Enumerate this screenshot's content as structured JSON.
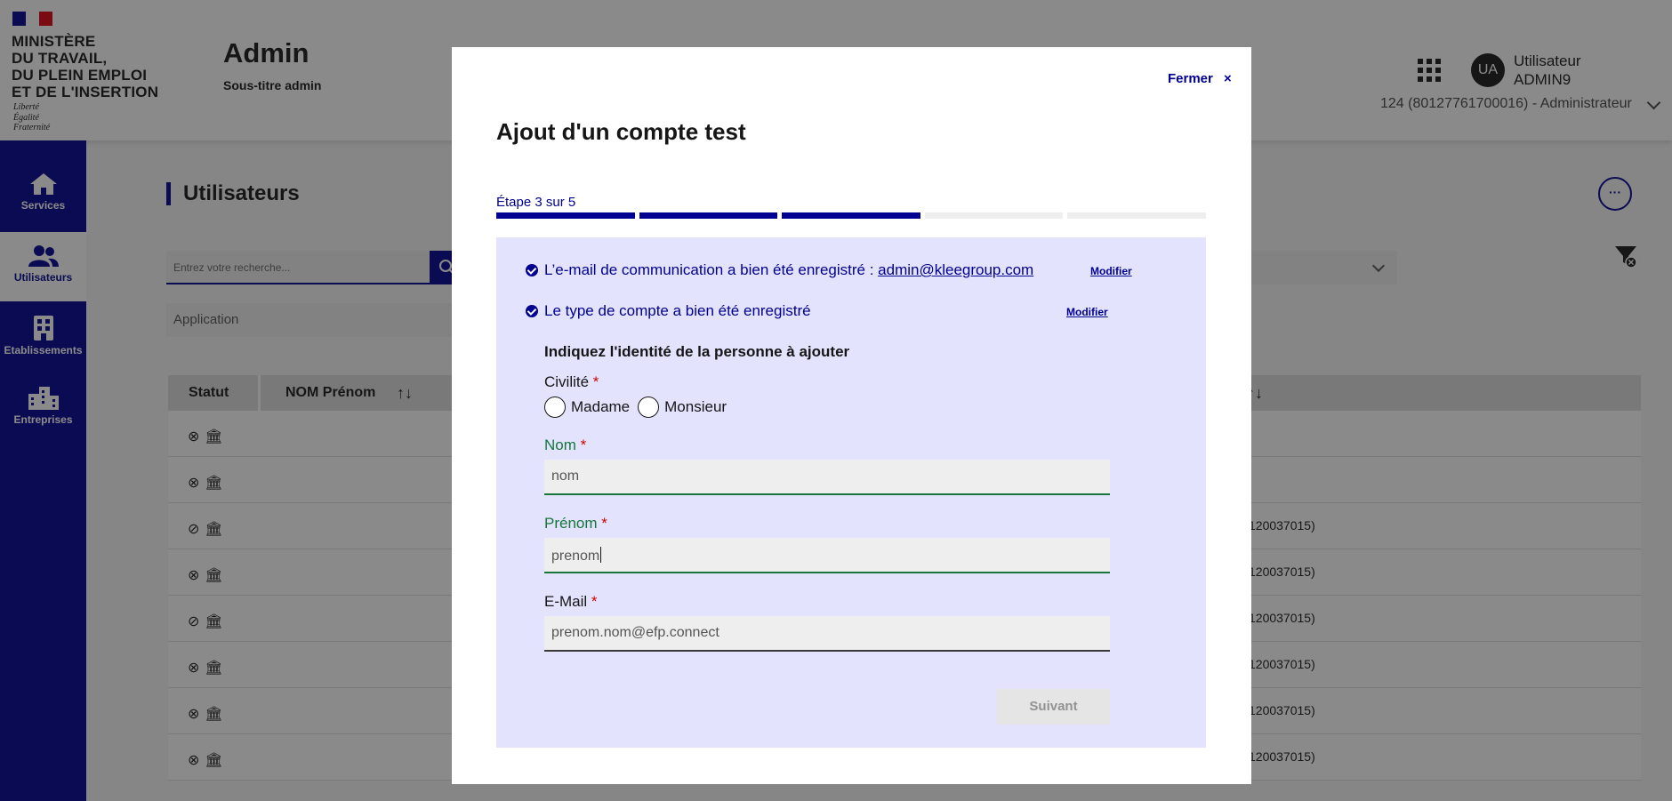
{
  "header": {
    "ministry_lines": [
      "MINISTÈRE",
      "DU TRAVAIL,",
      "DU PLEIN EMPLOI",
      "ET DE L'INSERTION"
    ],
    "motto_lines": [
      "Liberté",
      "Égalité",
      "Fraternité"
    ],
    "app_title": "Admin",
    "app_subtitle": "Sous-titre admin",
    "avatar_initials": "UA",
    "user_first": "Utilisateur",
    "user_last": "ADMIN9",
    "user_role": "124 (80127761700016) - Administrateur",
    "flag_colors": [
      "#000091",
      "#ffffff",
      "#e1000f"
    ]
  },
  "sidebar": {
    "items": [
      {
        "label": "Services",
        "icon": "home-icon",
        "active": false
      },
      {
        "label": "Utilisateurs",
        "icon": "users-icon",
        "active": true
      },
      {
        "label": "Etablissements",
        "icon": "building-icon",
        "active": false
      },
      {
        "label": "Entreprises",
        "icon": "city-icon",
        "active": false
      }
    ]
  },
  "main": {
    "page_title": "Utilisateurs",
    "more_label": "···",
    "search_placeholder": "Entrez votre recherche...",
    "select_application": "Application",
    "columns": [
      "Statut",
      "NOM Prénom"
    ],
    "sort_glyph": "↑↓",
    "rows": [
      {
        "status": "inactive",
        "right": ""
      },
      {
        "status": "inactive",
        "right": ""
      },
      {
        "status": "active",
        "right": "120037015)"
      },
      {
        "status": "inactive",
        "right": "120037015)"
      },
      {
        "status": "active",
        "right": "120037015)"
      },
      {
        "status": "inactive",
        "right": "120037015)"
      },
      {
        "status": "inactive",
        "right": "120037015)"
      },
      {
        "status": "inactive",
        "right": "120037015)"
      }
    ]
  },
  "modal": {
    "close_label": "Fermer",
    "close_glyph": "×",
    "title": "Ajout d'un compte test",
    "step_label": "Étape 3 sur 5",
    "step_current": 3,
    "step_total": 5,
    "email_msg": "L’e-mail de communication a bien été enregistré : ",
    "email_link": "admin@kleegroup.com",
    "type_msg": "Le type de compte a bien été enregistré",
    "modify_label": "Modifier",
    "form_heading": "Indiquez l'identité de la personne à ajouter",
    "civility_label": "Civilité",
    "civility_options": [
      "Madame",
      "Monsieur"
    ],
    "required_mark": "*",
    "nom_label": "Nom",
    "nom_value": "nom",
    "prenom_label": "Prénom",
    "prenom_value": "prenom",
    "email_label": "E-Mail",
    "email_value": "prenom.nom@efp.connect",
    "next_label": "Suivant"
  }
}
